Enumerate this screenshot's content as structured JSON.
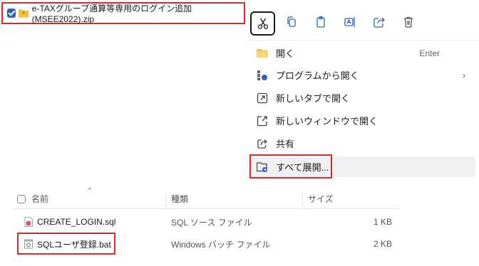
{
  "selected_file": {
    "name": "e-TAXグループ通算等専用のログイン追加(MSEE2022).zip"
  },
  "context_menu": {
    "items": [
      {
        "label": "開く",
        "accel": "Enter"
      },
      {
        "label": "プログラムから開く"
      },
      {
        "label": "新しいタブで開く"
      },
      {
        "label": "新しいウィンドウで開く"
      },
      {
        "label": "共有"
      },
      {
        "label": "すべて展開..."
      }
    ]
  },
  "file_list": {
    "columns": {
      "name": "名前",
      "type": "種類",
      "size": "サイズ"
    },
    "rows": [
      {
        "name": "CREATE_LOGIN.sql",
        "type": "SQL ソース ファイル",
        "size": "1 KB"
      },
      {
        "name": "SQLユーザ登録.bat",
        "type": "Windows バッチ ファイル",
        "size": "2 KB"
      }
    ]
  },
  "colors": {
    "highlight": "#d92a2a",
    "accent": "#2a63c5",
    "folder": "#f2c04a"
  }
}
